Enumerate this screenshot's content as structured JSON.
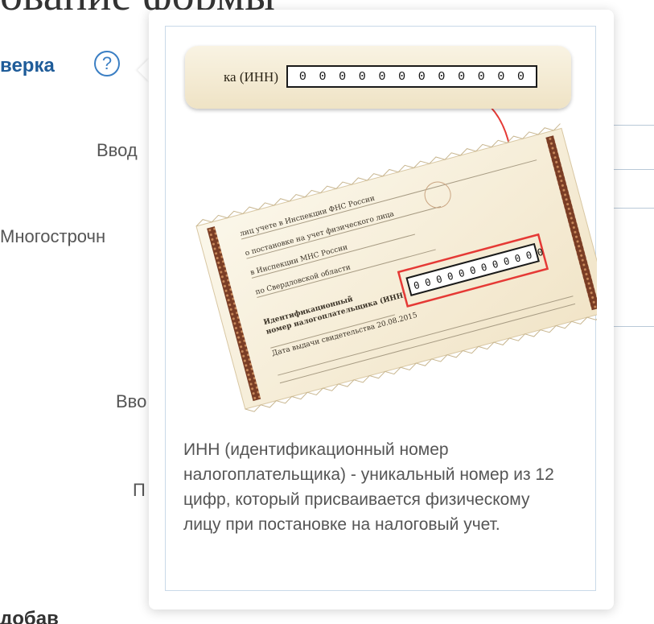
{
  "page": {
    "title_fragment": "ование формы",
    "section_title": "верка",
    "help_icon": "question-circle-icon",
    "labels": [
      "Ввод",
      "Многострочн",
      "Вво",
      "П"
    ],
    "bottom_text": "добав"
  },
  "tooltip": {
    "inn_label": "ка (ИНН)",
    "inn_digits": [
      "0",
      "0",
      "0",
      "0",
      "0",
      "0",
      "0",
      "0",
      "0",
      "0",
      "0",
      "0"
    ],
    "description": "ИНН (идентификационный номер налогоплательщика) - уникальный номер из 12 цифр, который присваивается физическому лицу при постановке на налоговый учет.",
    "accent_color": "#e53935"
  }
}
